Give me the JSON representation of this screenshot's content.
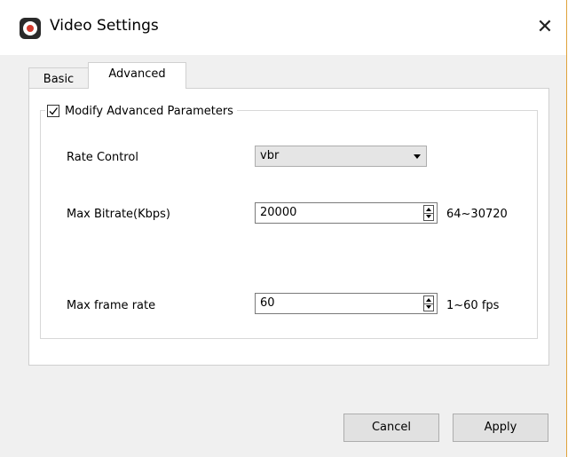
{
  "window": {
    "title": "Video Settings",
    "close_label": "✕"
  },
  "tabs": [
    {
      "label": "Basic",
      "active": false
    },
    {
      "label": "Advanced",
      "active": true
    }
  ],
  "advanced": {
    "group_label": "Modify Advanced Parameters",
    "group_checked": true,
    "rate_control": {
      "label": "Rate Control",
      "value": "vbr"
    },
    "max_bitrate": {
      "label": "Max Bitrate(Kbps)",
      "value": "20000",
      "range": "64~30720"
    },
    "max_frame_rate": {
      "label": "Max frame rate",
      "value": "60",
      "range": "1~60 fps"
    }
  },
  "footer": {
    "cancel_label": "Cancel",
    "apply_label": "Apply"
  },
  "colors": {
    "window_border": "#e0a23a",
    "background": "#f0f0f0",
    "button_face": "#e1e1e1"
  },
  "icons": {
    "app": "app-logo-icon",
    "close": "close-icon",
    "check": "check-icon",
    "dropdown": "chevron-down-icon",
    "spin": "spinner-arrows-icon"
  }
}
